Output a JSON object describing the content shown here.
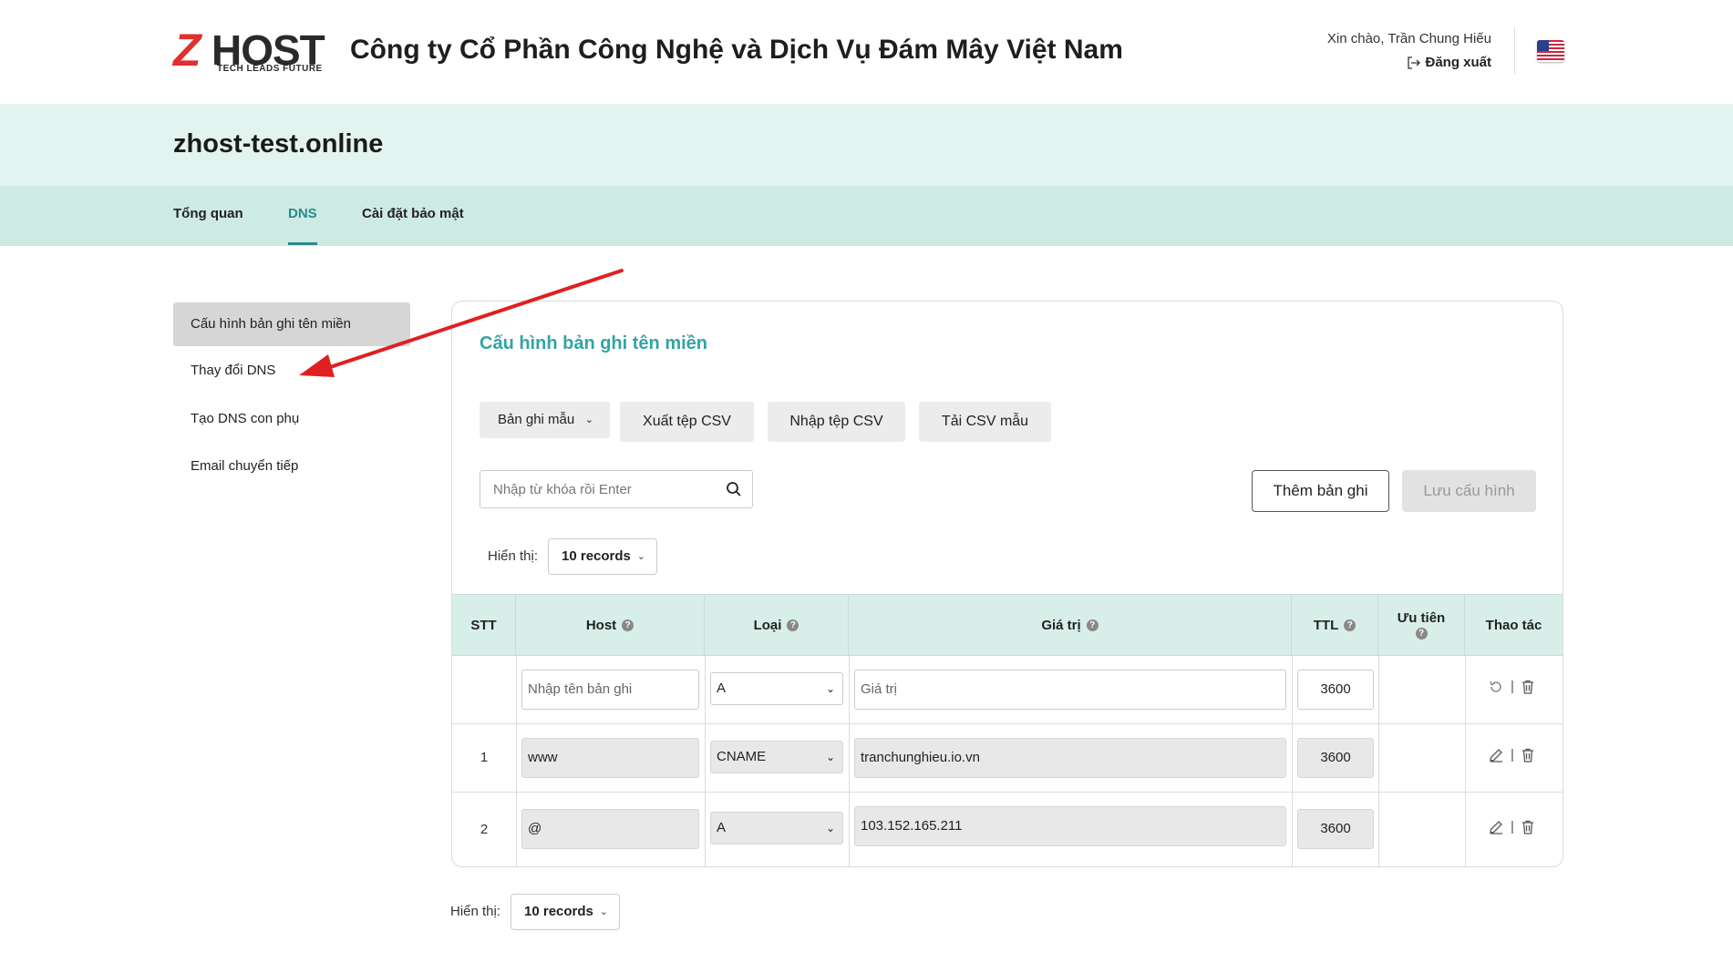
{
  "header": {
    "logo_mark": "Z",
    "logo_text": "HOST",
    "logo_tagline": "TECH LEADS FUTURE",
    "company_name": "Công ty Cổ Phần Công Nghệ và Dịch Vụ Đám Mây Việt Nam",
    "greeting": "Xin chào, Trần Chung Hiếu",
    "logout_label": "Đăng xuất",
    "language_icon": "us-flag-icon"
  },
  "domain": "zhost-test.online",
  "tabs": [
    {
      "label": "Tổng quan",
      "active": false
    },
    {
      "label": "DNS",
      "active": true
    },
    {
      "label": "Cài đặt bảo mật",
      "active": false
    }
  ],
  "sidebar": {
    "items": [
      {
        "label": "Cấu hình bản ghi tên miền",
        "active": true
      },
      {
        "label": "Thay đổi DNS",
        "active": false
      },
      {
        "label": "Tạo DNS con phụ",
        "active": false
      },
      {
        "label": "Email chuyển tiếp",
        "active": false
      }
    ]
  },
  "panel": {
    "title": "Cấu hình bản ghi tên miền",
    "template_button": "Bản ghi mẫu",
    "export_csv": "Xuất tệp CSV",
    "import_csv": "Nhập tệp CSV",
    "download_csv": "Tải CSV mẫu",
    "search_placeholder": "Nhập từ khóa rồi Enter",
    "add_record": "Thêm bản ghi",
    "save_config": "Lưu cấu hình",
    "show_label": "Hiển thị:",
    "page_size": "10 records"
  },
  "table": {
    "columns": [
      "STT",
      "Host",
      "Loại",
      "Giá trị",
      "TTL",
      "Ưu tiên",
      "Thao tác"
    ],
    "new_row": {
      "host_placeholder": "Nhập tên bản ghi",
      "type": "A",
      "value_placeholder": "Giá trị",
      "ttl": "3600"
    },
    "rows": [
      {
        "stt": "1",
        "host": "www",
        "type": "CNAME",
        "value": "tranchunghieu.io.vn",
        "ttl": "3600",
        "priority": ""
      },
      {
        "stt": "2",
        "host": "@",
        "type": "A",
        "value": "103.152.165.211",
        "ttl": "3600",
        "priority": ""
      }
    ],
    "action_separator": "|"
  },
  "footer": {
    "show_label": "Hiển thị:",
    "page_size": "10 records"
  },
  "colors": {
    "accent": "#34a3a3",
    "band": "#e3f3ef",
    "tabs_band": "#cdebe4",
    "arrow": "#e02020"
  }
}
